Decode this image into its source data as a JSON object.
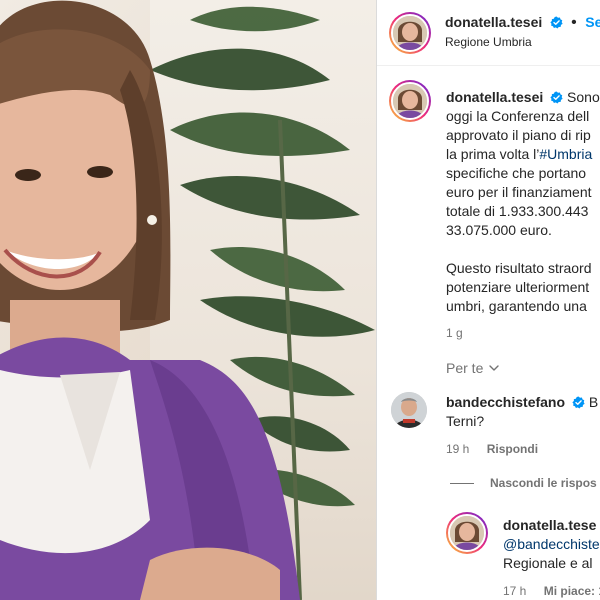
{
  "header": {
    "username": "donatella.tesei",
    "location": "Regione Umbria",
    "follow_label": "Se"
  },
  "post": {
    "caption_lines": [
      "donatella.tesei",
      "Sono",
      "oggi la Conferenza dell",
      "approvato il piano di rip",
      "la prima volta l’",
      "#Umbria",
      "specifiche che portano",
      "euro per il finanziament",
      "totale di 1.933.300.443",
      "33.075.000 euro.",
      "Questo risultato straord",
      "potenziare ulteriorment",
      "umbri, garantendo una"
    ],
    "time": "1 g"
  },
  "filter": {
    "label": "Per te"
  },
  "comments": [
    {
      "username": "bandecchistefano",
      "text_first": "B",
      "text_second": "Terni?",
      "time": "19 h",
      "reply_label": "Rispondi"
    }
  ],
  "hide_replies_label": "Nascondi le rispos",
  "reply": {
    "username": "donatella.tese",
    "mention": "@bandecchiste",
    "text": "Regionale e al",
    "time": "17 h",
    "likes_label": "Mi piace: 1"
  },
  "colors": {
    "accent_blue": "#0095f6",
    "verified_blue": "#0095f6",
    "jacket_purple": "#7a4aa0"
  },
  "icons": {
    "verified": "verified-badge-icon",
    "chevron": "chevron-down-icon"
  }
}
